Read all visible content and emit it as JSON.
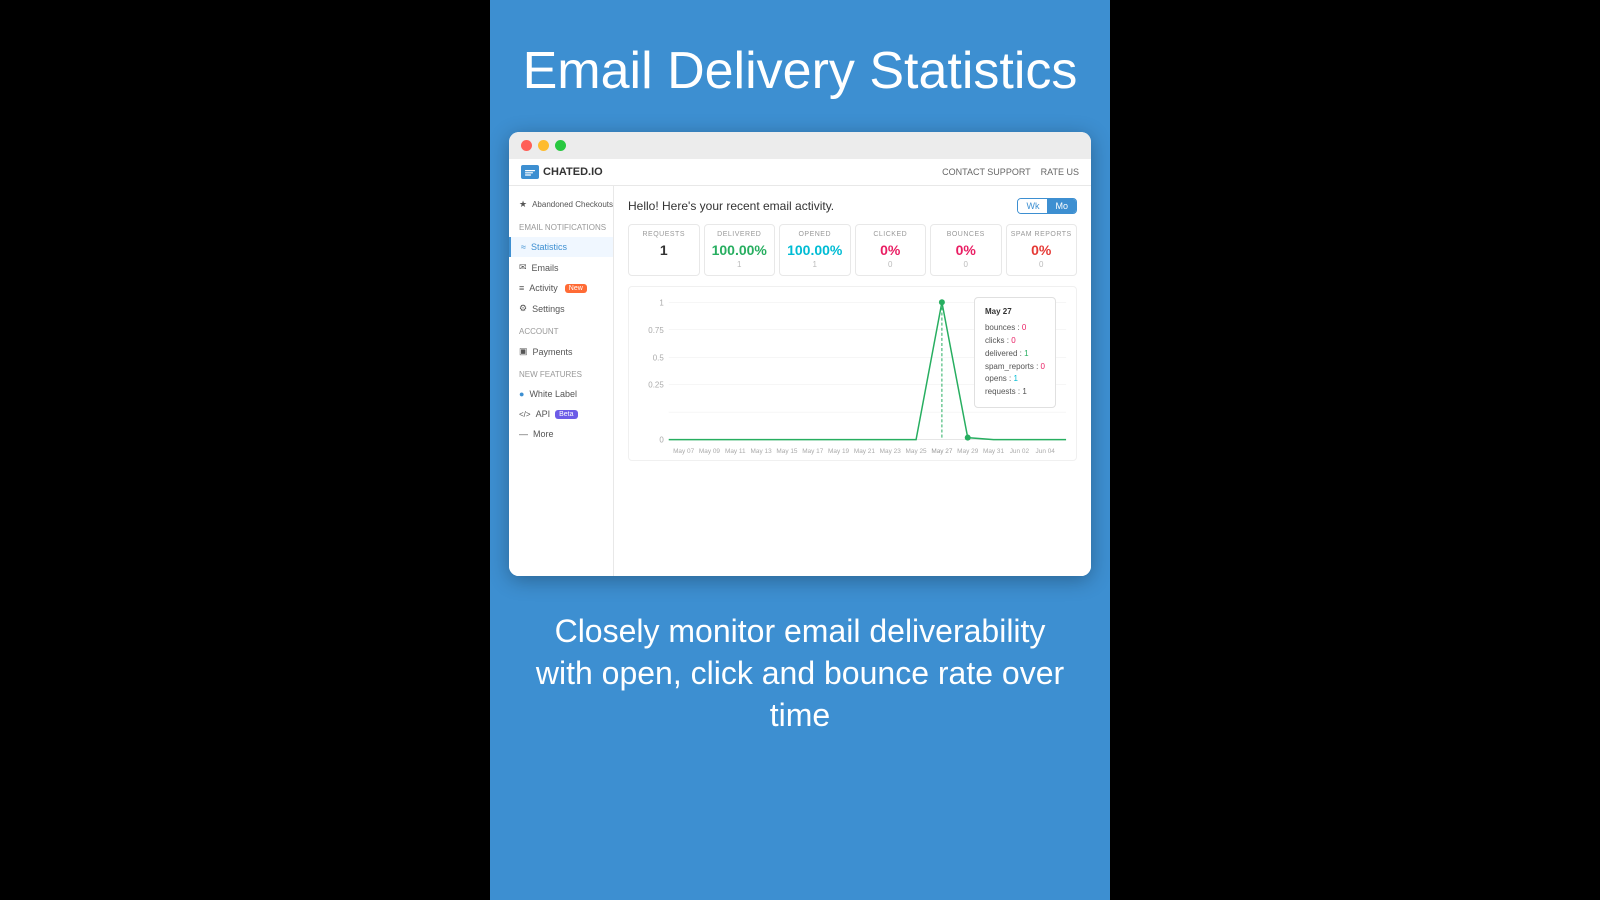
{
  "page": {
    "title": "Email Delivery Statistics",
    "subtitle": "Closely monitor email deliverability with open, click and bounce rate over time"
  },
  "browser": {
    "dots": [
      "red",
      "yellow",
      "green"
    ]
  },
  "app_header": {
    "logo_text": "CHATED.IO",
    "contact_support": "CONTACT SUPPORT",
    "rate_us": "RATE US"
  },
  "sidebar": {
    "items": [
      {
        "label": "Abandoned Checkouts",
        "icon": "★",
        "active": false
      },
      {
        "label": "Email Notifications",
        "section_header": true
      },
      {
        "label": "Statistics",
        "icon": "≈",
        "active": true
      },
      {
        "label": "Emails",
        "icon": "✉",
        "active": false
      },
      {
        "label": "Activity",
        "icon": "≡",
        "active": false,
        "badge": "New"
      },
      {
        "label": "Settings",
        "icon": "⚙",
        "active": false
      },
      {
        "label": "Account",
        "section_header": true
      },
      {
        "label": "Payments",
        "icon": "▣",
        "active": false
      },
      {
        "label": "New Features",
        "section_header": true
      },
      {
        "label": "White Label",
        "icon": "●",
        "active": false
      },
      {
        "label": "API",
        "icon": "</>",
        "active": false,
        "badge": "Beta"
      },
      {
        "label": "More",
        "icon": "—",
        "active": false
      }
    ]
  },
  "stats_header": {
    "greeting": "Hello! Here's your recent email activity.",
    "period_week": "Wk",
    "period_month": "Mo"
  },
  "stat_cards": [
    {
      "label": "REQUESTS",
      "value": "1",
      "sub": "",
      "color": "default"
    },
    {
      "label": "DELIVERED",
      "value": "100.00%",
      "sub": "1",
      "color": "green"
    },
    {
      "label": "OPENED",
      "value": "100.00%",
      "sub": "1",
      "color": "cyan"
    },
    {
      "label": "CLICKED",
      "value": "0%",
      "sub": "0",
      "color": "pink"
    },
    {
      "label": "BOUNCES",
      "value": "0%",
      "sub": "0",
      "color": "pink"
    },
    {
      "label": "SPAM REPORTS",
      "value": "0%",
      "sub": "0",
      "color": "red"
    }
  ],
  "chart": {
    "x_labels": [
      "May 07",
      "May 09",
      "May 11",
      "May 13",
      "May 15",
      "May 17",
      "May 19",
      "May 21",
      "May 23",
      "May 25",
      "May 27",
      "May 29",
      "May 31",
      "Jun 02",
      "Jun 04"
    ],
    "y_labels": [
      "1",
      "0.75",
      "0.5",
      "0.25",
      "0"
    ],
    "spike_x": "May 27"
  },
  "tooltip": {
    "date": "May 27",
    "rows": [
      {
        "key": "bounces",
        "value": "0",
        "color": "pink"
      },
      {
        "key": "clicks",
        "value": "0",
        "color": "pink"
      },
      {
        "key": "delivered",
        "value": "1",
        "color": "green"
      },
      {
        "key": "spam_reports",
        "value": "0",
        "color": "pink"
      },
      {
        "key": "opens",
        "value": "1",
        "color": "cyan"
      },
      {
        "key": "requests",
        "value": "1",
        "color": "default"
      }
    ]
  }
}
